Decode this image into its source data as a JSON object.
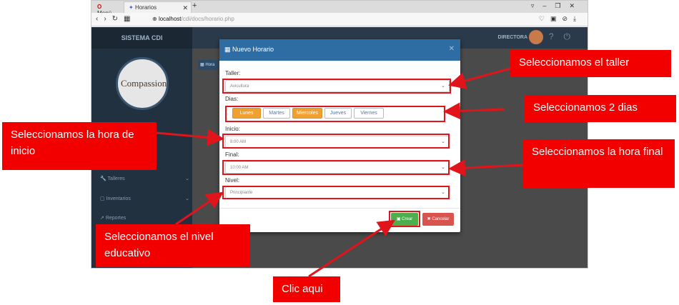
{
  "browser": {
    "tabs": [
      {
        "label": "Menú"
      },
      {
        "label": "Horarios"
      }
    ],
    "new_tab": "+",
    "url_host": "localhost",
    "url_path": "/cdi/docs/horario.php"
  },
  "app": {
    "brand": "SISTEMA CDI",
    "logo_text": "Compassion",
    "user_role": "DIRECTORA",
    "content_button": "Hora",
    "sidebar": [
      {
        "label": "Talleres"
      },
      {
        "label": "Inventarios"
      },
      {
        "label": "Reportes"
      }
    ]
  },
  "modal": {
    "title": "Nuevo Horario",
    "taller_label": "Taller:",
    "taller_value": "Avicultura",
    "dias_label": "Dias:",
    "days": [
      {
        "label": "Lunes",
        "selected": true
      },
      {
        "label": "Martes",
        "selected": false
      },
      {
        "label": "Miercoles",
        "selected": true
      },
      {
        "label": "Jueves",
        "selected": false
      },
      {
        "label": "Viernes",
        "selected": false
      }
    ],
    "inicio_label": "Inicio:",
    "inicio_value": "8:00 AM",
    "final_label": "Final:",
    "final_value": "10:00 AM",
    "nivel_label": "Nivel:",
    "nivel_value": "Principiante",
    "crear_label": "Crear",
    "cancelar_label": "Cancelar"
  },
  "callouts": {
    "taller": "Seleccionamos el taller",
    "dias": "Seleccionamos 2 dias",
    "inicio": "Seleccionamos la hora de inicio",
    "final": "Seleccionamos la hora final",
    "nivel": "Seleccionamos el nivel educativo",
    "clic": "Clic aqui"
  },
  "colors": {
    "annotation_red": "#f20000",
    "modal_header": "#2e6da4",
    "day_selected": "#f0a030",
    "btn_crear": "#4cae4c",
    "btn_cancelar": "#d9534f"
  }
}
